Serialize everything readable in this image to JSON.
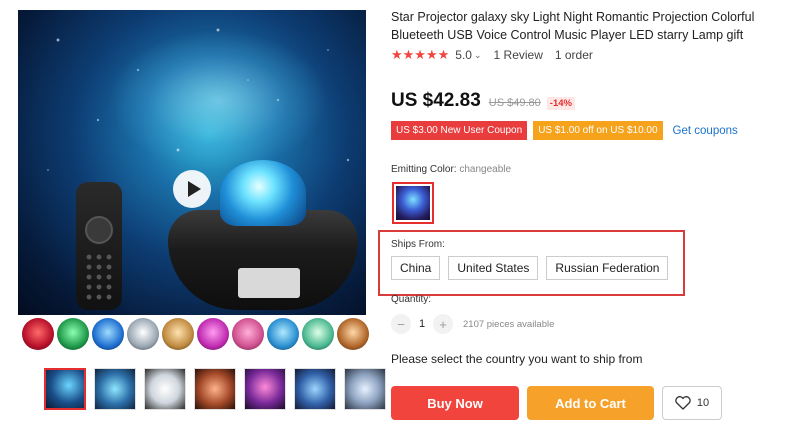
{
  "product": {
    "title": "Star Projector galaxy sky Light Night Romantic Projection Colorful Blueteeth USB Voice Control Music Player LED starry Lamp gift",
    "rating_stars": "★★★★★",
    "rating_value": "5.0",
    "reviews": "1 Review",
    "orders": "1 order"
  },
  "price": {
    "current": "US $42.83",
    "original": "US $49.80",
    "discount": "-14%"
  },
  "coupons": {
    "new_user": "US $3.00 New User Coupon",
    "store": "US $1.00 off on US $10.00",
    "link": "Get coupons"
  },
  "emitting_color": {
    "label": "Emitting Color:",
    "value": "changeable"
  },
  "ships_from": {
    "label": "Ships From:",
    "options": [
      "China",
      "United States",
      "Russian Federation"
    ]
  },
  "quantity": {
    "label": "Quantity:",
    "value": "1",
    "minus": "−",
    "plus": "+",
    "available": "2107 pieces available"
  },
  "notice": "Please select the country you want to ship from",
  "actions": {
    "buy_now": "Buy Now",
    "add_to_cart": "Add to Cart",
    "wishlist_count": "10"
  },
  "colors": {
    "accent_red": "#f0443c",
    "accent_orange": "#f6a12a",
    "link_blue": "#1a73c9"
  }
}
